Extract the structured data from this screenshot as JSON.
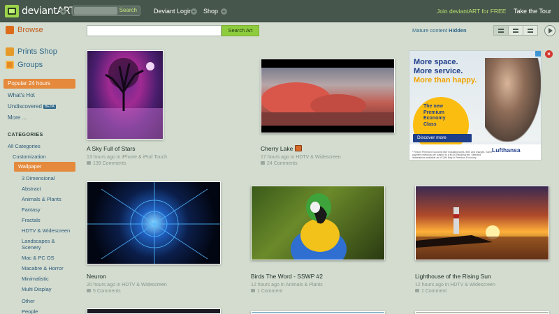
{
  "header": {
    "logo_text": "deviantART",
    "search_label": "Search",
    "nav": [
      "Deviant Login",
      "Shop"
    ],
    "join": "Join deviantART for FREE",
    "tour": "Take the Tour"
  },
  "sidebar": {
    "main": [
      "Browse",
      "Prints Shop",
      "Groups"
    ],
    "filters": {
      "popular": "Popular 24 hours",
      "hot": "What's Hot",
      "undiscovered": "Undiscovered",
      "beta": "BETA",
      "more": "More ..."
    },
    "categories_head": "CATEGORIES",
    "categories": [
      "All Categories",
      "Customization",
      "Wallpaper",
      "3 Dimensional",
      "Abstract",
      "Animals & Plants",
      "Fantasy",
      "Fractals",
      "HDTV & Widescreen",
      "Landscapes & Scenery",
      "Mac & PC OS",
      "Macabre & Horror",
      "Minimalistic",
      "Multi Display",
      "Other",
      "People"
    ]
  },
  "toolbar": {
    "search_button": "Search Art",
    "mature_label": "Mature content",
    "mature_value": "Hidden"
  },
  "deviations": [
    {
      "title": "A Sky Full of Stars",
      "meta": "13 hours ago in iPhone & iPod Touch",
      "comments": "139 Comments"
    },
    {
      "title": "Cherry Lake",
      "meta": "17 hours ago in HDTV & Widescreen",
      "comments": "24 Comments"
    },
    {
      "title": "Neuron",
      "meta": "20 hours ago in HDTV & Widescreen",
      "comments": "5 Comments"
    },
    {
      "title": "Birds The Word - SSWP #2",
      "meta": "12 hours ago in Animals & Plants",
      "comments": "1 Comment"
    },
    {
      "title": "Lighthouse of the Rising Sun",
      "meta": "12 hours ago in HDTV & Widescreen",
      "comments": "1 Comment"
    }
  ],
  "ad": {
    "line1": "More space.",
    "line2": "More service.",
    "line3": "More than happy.",
    "cap1": "The new",
    "cap2": "Premium",
    "cap3": "Economy",
    "cap4": "Class",
    "button": "Discover more",
    "brand": "Lufthansa",
    "fine": "* Return Premium Economy fare including taxes, fees and charges. Some payment methods are subject to a €4.50 handling fee. Selected destinations available as of 15th May in Premium Economy."
  },
  "colors": {
    "accent": "#e5893c",
    "brand": "#9bd44a",
    "link": "#2d5a7a"
  }
}
